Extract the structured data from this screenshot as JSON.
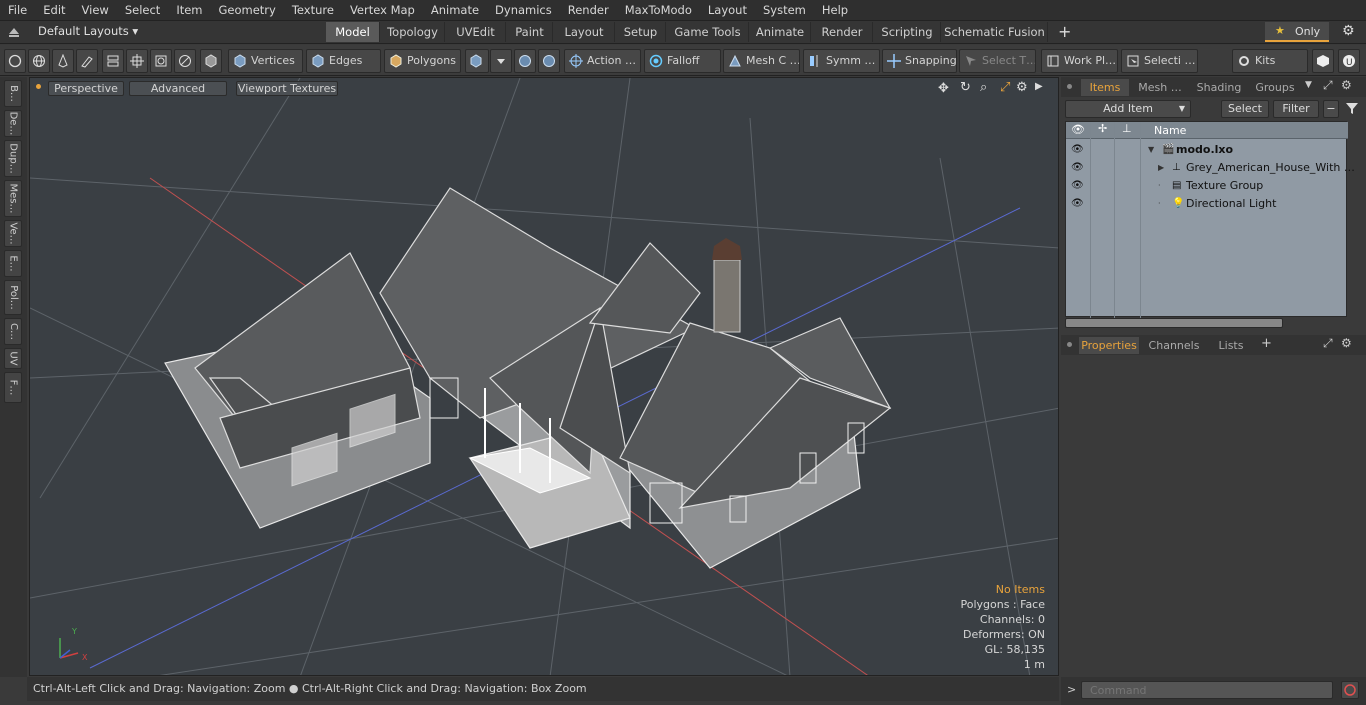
{
  "menu": [
    "File",
    "Edit",
    "View",
    "Select",
    "Item",
    "Geometry",
    "Texture",
    "Vertex Map",
    "Animate",
    "Dynamics",
    "Render",
    "MaxToModo",
    "Layout",
    "System",
    "Help"
  ],
  "layout_selector": "Default Layouts ▾",
  "layout_tabs": [
    "Model",
    "Topology",
    "UVEdit",
    "Paint",
    "Layout",
    "Setup",
    "Game Tools",
    "Animate",
    "Render",
    "Scripting",
    "Schematic Fusion"
  ],
  "active_layout_tab": "Model",
  "only_label": "Only",
  "toolbar": {
    "vertices": "Vertices",
    "edges": "Edges",
    "polygons": "Polygons",
    "action": "Action …",
    "falloff": "Falloff",
    "mesh": "Mesh C …",
    "symm": "Symm …",
    "snapping": "Snapping",
    "select_t": "Select T…",
    "work_pl": "Work Pl…",
    "selecti": "Selecti …",
    "kits": "Kits"
  },
  "left_tabs": [
    "B…",
    "De…",
    "Dup…",
    "Mes…",
    "Ve…",
    "E…",
    "Pol…",
    "C…",
    "UV",
    "F…"
  ],
  "viewport": {
    "perspective": "Perspective",
    "advanced": "Advanced",
    "viewport_textures": "Viewport Textures",
    "info": {
      "no_items": "No Items",
      "polygons": "Polygons : Face",
      "channels": "Channels: 0",
      "deformers": "Deformers: ON",
      "gl": "GL: 58,135",
      "scale": "1 m"
    }
  },
  "status": "Ctrl-Alt-Left Click and Drag: Navigation: Zoom ● Ctrl-Alt-Right Click and Drag: Navigation: Box Zoom",
  "items_panel": {
    "tabs": [
      "Items",
      "Mesh …",
      "Shading",
      "Groups"
    ],
    "add_item": "Add Item",
    "select": "Select",
    "filter": "Filter",
    "name_header": "Name",
    "rows": [
      {
        "label": "modo.lxo",
        "indent": 0,
        "bold": true
      },
      {
        "label": "Grey_American_House_With …",
        "indent": 1,
        "bold": false
      },
      {
        "label": "Texture Group",
        "indent": 1,
        "bold": false
      },
      {
        "label": "Directional Light",
        "indent": 1,
        "bold": false
      }
    ]
  },
  "properties_panel": {
    "tabs": [
      "Properties",
      "Channels",
      "Lists"
    ]
  },
  "command_placeholder": "Command",
  "colors": {
    "accent": "#e8a33c",
    "viewport_bg": "#3a3f44",
    "list_bg": "#909aa4"
  }
}
